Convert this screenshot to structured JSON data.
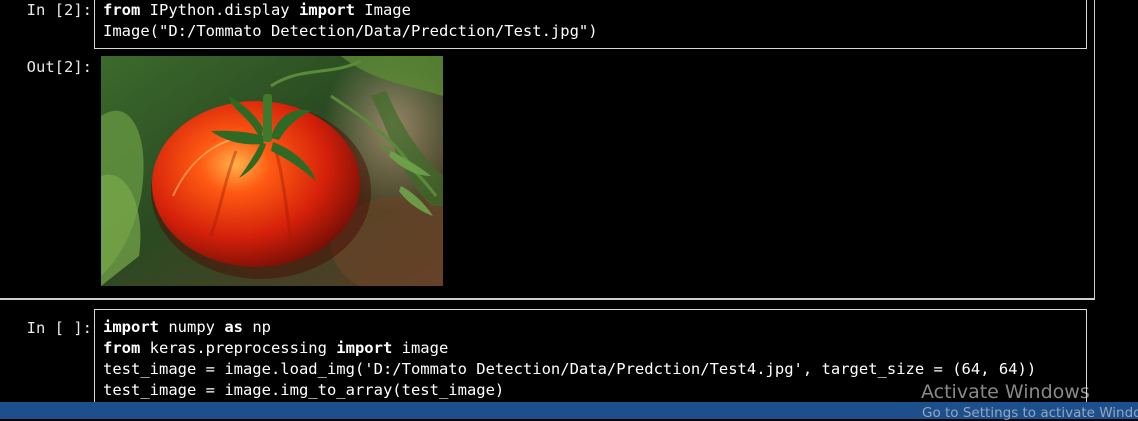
{
  "cells": [
    {
      "prompt": "In [2]:",
      "lines": [
        [
          {
            "t": "from",
            "kw": true
          },
          {
            "t": " IPython.display "
          },
          {
            "t": "import",
            "kw": true
          },
          {
            "t": " Image"
          }
        ],
        [
          {
            "t": "Image(\"D:/Tommato Detection/Data/Predction/Test.jpg\")"
          }
        ]
      ],
      "output_prompt": "Out[2]:"
    },
    {
      "prompt": "In [ ]:",
      "lines": [
        [
          {
            "t": "import",
            "kw": true
          },
          {
            "t": " numpy "
          },
          {
            "t": "as",
            "kw": true
          },
          {
            "t": " np"
          }
        ],
        [
          {
            "t": "from",
            "kw": true
          },
          {
            "t": " keras.preprocessing "
          },
          {
            "t": "import",
            "kw": true
          },
          {
            "t": " image"
          }
        ],
        [
          {
            "t": "test_image = image.load_img('D:/Tommato Detection/Data/Predction/Test4.jpg', target_size = (64, 64))"
          }
        ],
        [
          {
            "t": "test_image = image.img_to_array(test_image)"
          }
        ]
      ]
    }
  ],
  "watermark": {
    "title": "Activate Windows",
    "subtitle": "Go to Settings to activate Windo"
  },
  "colors": {
    "background": "#000000",
    "cell_border": "#d8d8d8",
    "taskbar": "#1c4f8b"
  }
}
